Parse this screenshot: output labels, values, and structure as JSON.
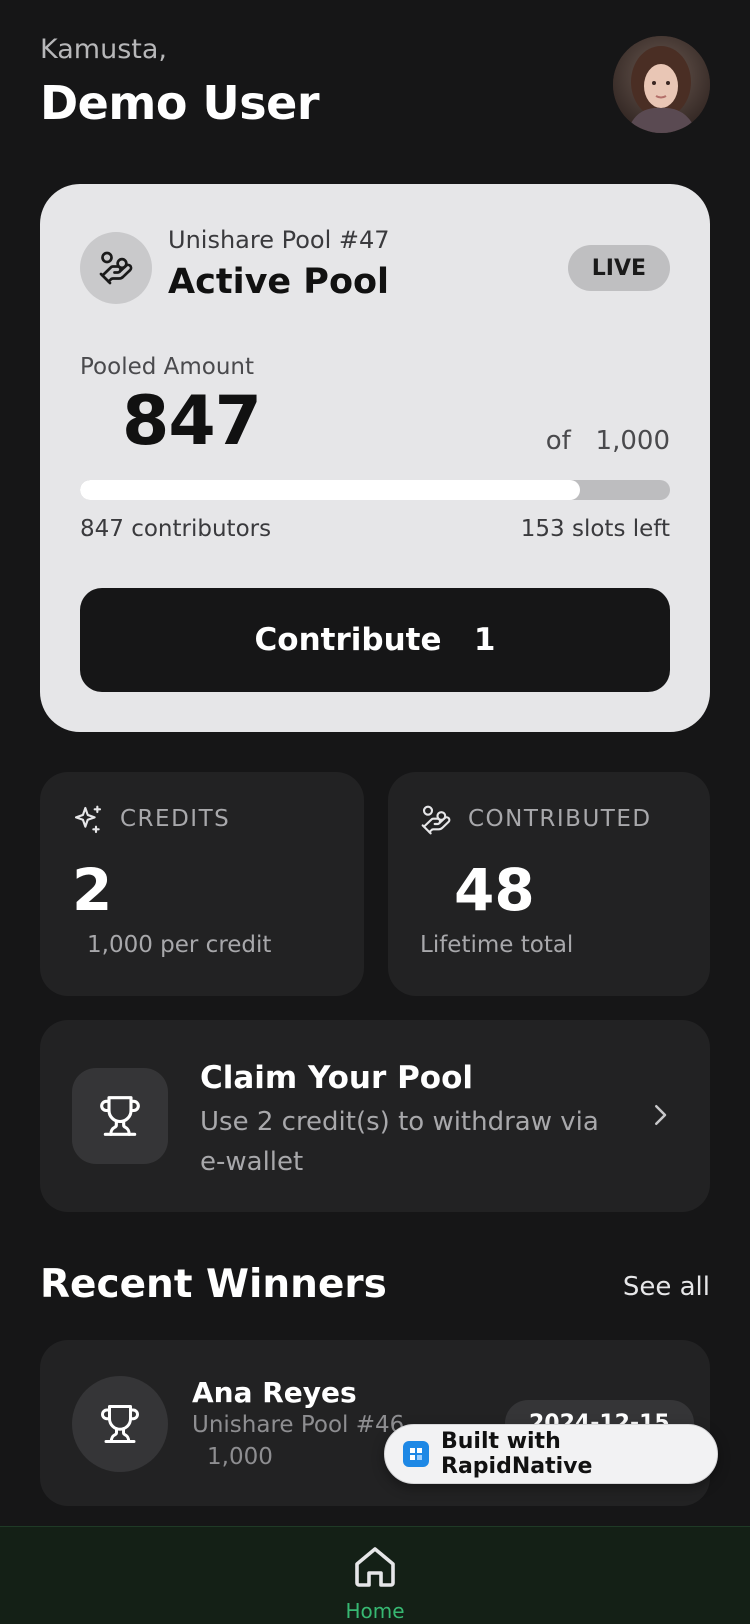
{
  "header": {
    "greeting": "Kamusta,",
    "username": "Demo User"
  },
  "pool": {
    "name": "Unishare Pool #47",
    "title": "Active Pool",
    "status_badge": "LIVE",
    "pooled_label": "Pooled Amount",
    "pooled_amount": "847",
    "of_text": "of   1,000",
    "progress_fraction": 0.847,
    "contributors": "847 contributors",
    "slots_left": "153 slots left",
    "contribute_label": "Contribute   1"
  },
  "stats": {
    "credits": {
      "label": "CREDITS",
      "value": "2",
      "sub": "1,000 per credit",
      "icon": "sparkle-icon"
    },
    "contributed": {
      "label": "CONTRIBUTED",
      "value": "48",
      "sub": "Lifetime total",
      "icon": "hand-coins-icon"
    }
  },
  "claim": {
    "title": "Claim Your Pool",
    "description": "Use 2 credit(s) to withdraw via e-wallet",
    "icon": "trophy-icon"
  },
  "winners": {
    "section_title": "Recent Winners",
    "see_all": "See all",
    "items": [
      {
        "name": "Ana Reyes",
        "pool": "Unishare Pool #46",
        "amount": "1,000",
        "date": "2024-12-15"
      }
    ]
  },
  "badge": {
    "text": "Built with RapidNative"
  },
  "nav": {
    "home_label": "Home"
  },
  "colors": {
    "background": "#161617",
    "card": "#222223",
    "pool_card": "#e6e6e8",
    "nav_active": "#37b872"
  }
}
